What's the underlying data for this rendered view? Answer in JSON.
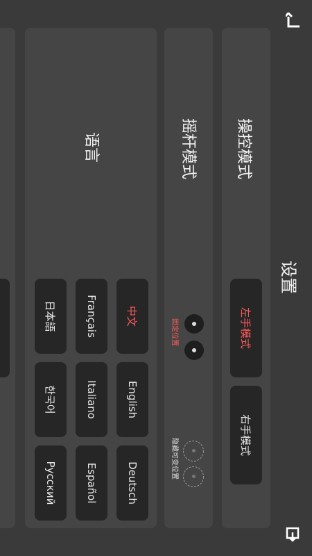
{
  "header": {
    "title": "设置",
    "back_icon": "back-arrow-icon",
    "menu_icon": "exit-icon"
  },
  "control_mode": {
    "title": "操控模式",
    "options": [
      {
        "label": "左手模式",
        "selected": true
      },
      {
        "label": "右手模式",
        "selected": false
      }
    ]
  },
  "joystick_mode": {
    "title": "摇杆模式",
    "fixed_label": "固定位置",
    "hidden_label": "隐藏可变位置"
  },
  "language": {
    "title": "语言",
    "options": [
      {
        "label": "中文",
        "selected": true
      },
      {
        "label": "English",
        "selected": false
      },
      {
        "label": "Deutsch",
        "selected": false
      },
      {
        "label": "Français",
        "selected": false
      },
      {
        "label": "Italiano",
        "selected": false
      },
      {
        "label": "Español",
        "selected": false
      },
      {
        "label": "日本語",
        "selected": false
      },
      {
        "label": "한국어",
        "selected": false
      },
      {
        "label": "Русский",
        "selected": false
      }
    ]
  },
  "colors": {
    "accent": "#ff5a5a",
    "panel": "#454545",
    "button": "#262626"
  }
}
